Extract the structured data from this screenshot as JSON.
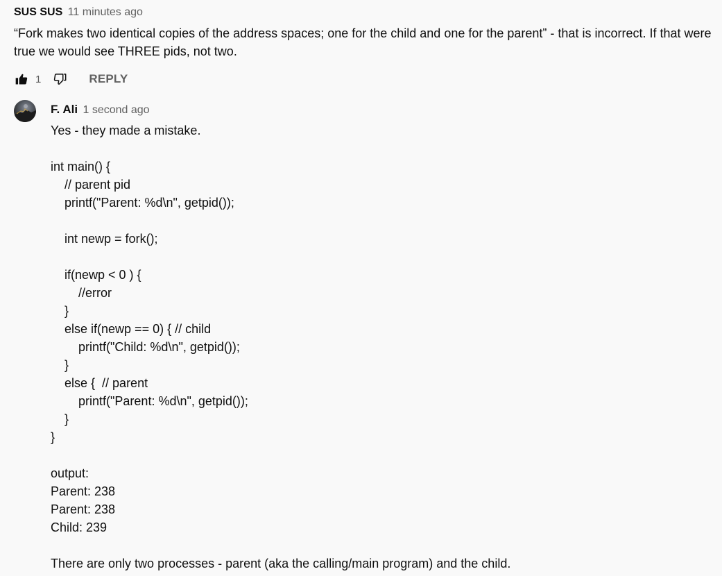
{
  "comment": {
    "author": "SUS SUS",
    "time": "11 minutes ago",
    "text": "“Fork makes two identical copies of the address spaces; one for the child and one for the parent” - that is incorrect. If that were true we would see THREE pids, not two.",
    "likes": "1",
    "reply_label": "REPLY",
    "icons": {
      "like": "thumbs-up-icon",
      "dislike": "thumbs-down-icon"
    }
  },
  "reply": {
    "author": "F. Ali",
    "time": "1 second ago",
    "avatar": "avatar",
    "lines": [
      "Yes - they made a mistake.",
      "",
      "int main() {",
      "    // parent pid",
      "    printf(\"Parent: %d\\n\", getpid());",
      "",
      "    int newp = fork();",
      "",
      "    if(newp < 0 ) {",
      "        //error",
      "    }",
      "    else if(newp == 0) { // child",
      "        printf(\"Child: %d\\n\", getpid());",
      "    }",
      "    else {  // parent",
      "        printf(\"Parent: %d\\n\", getpid());",
      "    }",
      "}",
      "",
      "output:",
      "Parent: 238",
      "Parent: 238",
      "Child: 239",
      "",
      "There are only two processes - parent (aka the calling/main program) and the child."
    ]
  }
}
